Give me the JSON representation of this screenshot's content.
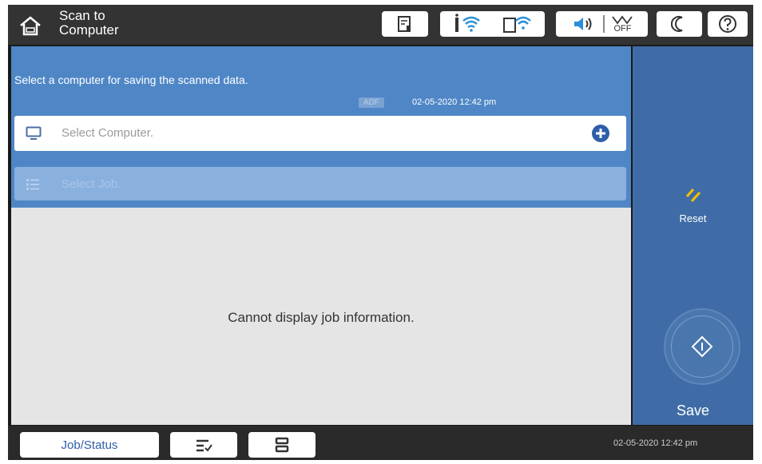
{
  "header": {
    "title_line1": "Scan to",
    "title_line2": "Computer",
    "icons": [
      "home-icon",
      "paper-cartridge-icon",
      "wifi-icon",
      "wifi-direct-icon",
      "volume-icon",
      "eco-off-icon",
      "sleep-moon-icon",
      "help-icon"
    ],
    "eco_label": "OFF"
  },
  "main": {
    "instruction": "Select a computer for saving the scanned data.",
    "adf_badge": "ADF",
    "timestamp": "02-05-2020 12:42 pm",
    "select_computer": "Select Computer.",
    "select_job": "Select Job.",
    "empty_message": "Cannot display job information."
  },
  "side": {
    "reset_label": "Reset",
    "save_label": "Save"
  },
  "footer": {
    "job_status_label": "Job/Status",
    "timestamp": "02-05-2020 12:42 pm"
  },
  "colors": {
    "accent_blue": "#4f86c6",
    "side_blue": "#3f6ca6",
    "reset_yellow": "#f2c200"
  }
}
